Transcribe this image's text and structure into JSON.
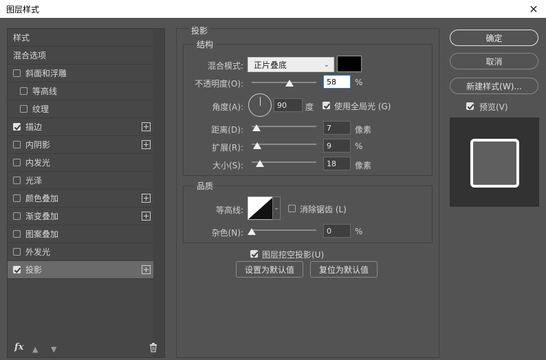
{
  "window": {
    "title": "图层样式",
    "close_icon": "close-icon"
  },
  "sidebar": {
    "items": [
      {
        "label": "样式",
        "checkbox": false,
        "checked": false,
        "plus": false,
        "indent": 0
      },
      {
        "label": "混合选项",
        "checkbox": false,
        "checked": false,
        "plus": false,
        "indent": 0
      },
      {
        "label": "斜面和浮雕",
        "checkbox": true,
        "checked": false,
        "plus": false,
        "indent": 0
      },
      {
        "label": "等高线",
        "checkbox": true,
        "checked": false,
        "plus": false,
        "indent": 1
      },
      {
        "label": "纹理",
        "checkbox": true,
        "checked": false,
        "plus": false,
        "indent": 1
      },
      {
        "label": "描边",
        "checkbox": true,
        "checked": true,
        "plus": true,
        "indent": 0
      },
      {
        "label": "内阴影",
        "checkbox": true,
        "checked": false,
        "plus": true,
        "indent": 0
      },
      {
        "label": "内发光",
        "checkbox": true,
        "checked": false,
        "plus": false,
        "indent": 0
      },
      {
        "label": "光泽",
        "checkbox": true,
        "checked": false,
        "plus": false,
        "indent": 0
      },
      {
        "label": "颜色叠加",
        "checkbox": true,
        "checked": false,
        "plus": true,
        "indent": 0
      },
      {
        "label": "渐变叠加",
        "checkbox": true,
        "checked": false,
        "plus": true,
        "indent": 0
      },
      {
        "label": "图案叠加",
        "checkbox": true,
        "checked": false,
        "plus": false,
        "indent": 0
      },
      {
        "label": "外发光",
        "checkbox": true,
        "checked": false,
        "plus": false,
        "indent": 0
      },
      {
        "label": "投影",
        "checkbox": true,
        "checked": true,
        "plus": true,
        "indent": 0,
        "active": true
      }
    ],
    "footer": {
      "fx": "fx"
    }
  },
  "main": {
    "section_title": "投影",
    "structure": {
      "title": "结构",
      "blend_mode_label": "混合模式:",
      "blend_mode_value": "正片叠底",
      "shadow_color": "#000000",
      "opacity_label": "不透明度(O):",
      "opacity_value": "58",
      "opacity_unit": "%",
      "angle_label": "角度(A):",
      "angle_value": "90",
      "angle_unit": "度",
      "global_light_label": "使用全局光 (G)",
      "global_light_checked": true,
      "distance_label": "距离(D):",
      "distance_value": "7",
      "distance_unit": "像素",
      "spread_label": "扩展(R):",
      "spread_value": "9",
      "spread_unit": "%",
      "size_label": "大小(S):",
      "size_value": "18",
      "size_unit": "像素"
    },
    "quality": {
      "title": "品质",
      "contour_label": "等高线:",
      "anti_alias_label": "消除锯齿 (L)",
      "anti_alias_checked": false,
      "noise_label": "杂色(N):",
      "noise_value": "0",
      "noise_unit": "%"
    },
    "knockout_label": "图层挖空投影(U)",
    "knockout_checked": true,
    "set_default_label": "设置为默认值",
    "reset_default_label": "复位为默认值"
  },
  "right": {
    "ok_label": "确定",
    "cancel_label": "取消",
    "new_style_label": "新建样式(W)...",
    "preview_label": "预览(V)",
    "preview_checked": true
  }
}
